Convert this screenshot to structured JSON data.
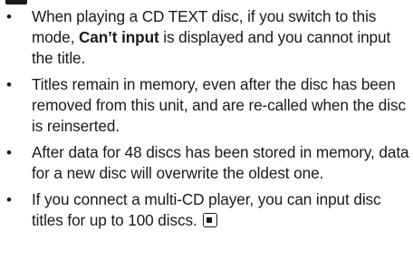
{
  "notes": [
    {
      "before": "When playing a CD TEXT disc, if you switch to this mode, ",
      "bold": "Can’t input",
      "after": " is displayed and you cannot input the title."
    },
    {
      "text": "Titles remain in memory, even after the disc has been removed from this unit, and are re-called when the disc is reinserted."
    },
    {
      "text": "After data for 48 discs has been stored in memory, data for a new disc will overwrite the oldest one."
    },
    {
      "text": "If you connect a multi-CD player, you can input disc titles for up to 100 discs."
    }
  ],
  "bullet_glyph": "•"
}
